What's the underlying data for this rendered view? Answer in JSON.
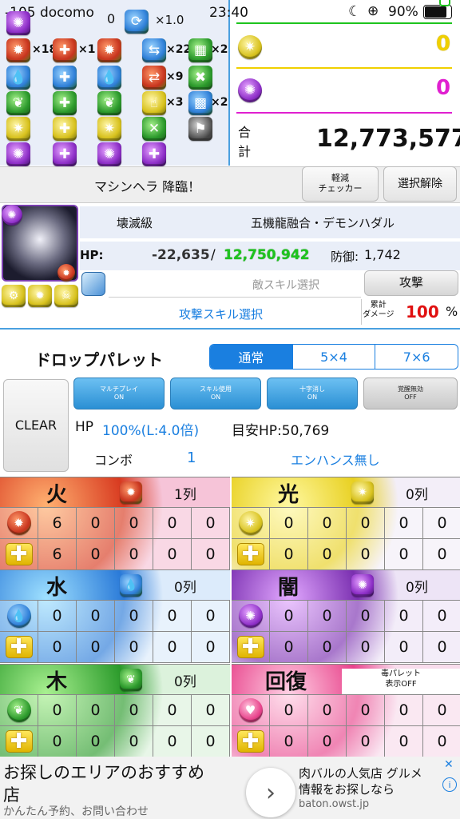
{
  "status": {
    "signal": "-105 docomo",
    "wifi_val": "0",
    "time": "23:40",
    "battery": "90%",
    "speed": "×1.0"
  },
  "counts": {
    "r1": [
      "×18",
      "×1",
      "",
      "×22",
      "×2"
    ],
    "r2": [
      "",
      "",
      "",
      "×9",
      ""
    ],
    "r3": [
      "",
      "",
      "",
      "×3",
      "×2"
    ]
  },
  "right_panel": {
    "light_val": "0",
    "dark_val": "0",
    "total_label_1": "合",
    "total_label_2": "計",
    "total": "12,773,577"
  },
  "toolbar": {
    "title": "マシンヘラ 降臨！",
    "checker": "軽減\nチェッカー",
    "clear_select": "選択解除"
  },
  "enemy": {
    "difficulty": "壊滅級",
    "name": "五機龍融合・デモンハダル",
    "hp_label": "HP:",
    "hp_damage": "-22,635",
    "hp_sep": "/",
    "hp_value": "12,750,942",
    "def_label": "防御:",
    "def_value": "1,742",
    "enemy_skill_placeholder": "敵スキル選択",
    "attack_btn": "攻撃",
    "attack_skill": "攻撃スキル選択",
    "cum_label": "累計\nダメージ",
    "cum_value": "100",
    "cum_unit": "%"
  },
  "palette": {
    "title": "ドロップパレット",
    "seg": [
      "通常",
      "5×4",
      "7×6"
    ],
    "clear": "CLEAR",
    "multi": [
      "マルチプレイ",
      "ON"
    ],
    "skill": [
      "スキル使用",
      "ON"
    ],
    "cross": [
      "十字消し",
      "ON"
    ],
    "awake": [
      "覚醒無効",
      "OFF"
    ],
    "hp_label": "HP",
    "hp_value": "100%(L:4.0倍)",
    "target": "目安HP:50,769",
    "combo_label": "コンボ",
    "combo_value": "1",
    "enhance": "エンハンス無し",
    "poison": "毒パレット\n表示OFF"
  },
  "attrs": {
    "fire": {
      "label": "火",
      "rows": "1列",
      "r1": [
        "6",
        "0",
        "0",
        "0",
        "0"
      ],
      "r2": [
        "6",
        "0",
        "0",
        "0",
        "0"
      ]
    },
    "light": {
      "label": "光",
      "rows": "0列",
      "r1": [
        "0",
        "0",
        "0",
        "0",
        "0"
      ],
      "r2": [
        "0",
        "0",
        "0",
        "0",
        "0"
      ]
    },
    "water": {
      "label": "水",
      "rows": "0列",
      "r1": [
        "0",
        "0",
        "0",
        "0",
        "0"
      ],
      "r2": [
        "0",
        "0",
        "0",
        "0",
        "0"
      ]
    },
    "dark": {
      "label": "闇",
      "rows": "0列",
      "r1": [
        "0",
        "0",
        "0",
        "0",
        "0"
      ],
      "r2": [
        "0",
        "0",
        "0",
        "0",
        "0"
      ]
    },
    "wood": {
      "label": "木",
      "rows": "0列",
      "r1": [
        "0",
        "0",
        "0",
        "0",
        "0"
      ],
      "r2": [
        "0",
        "0",
        "0",
        "0",
        "0"
      ]
    },
    "heal": {
      "label": "回復",
      "r1": [
        "0",
        "0",
        "0",
        "0",
        "0"
      ],
      "r2": [
        "0",
        "0",
        "0",
        "0",
        "0"
      ]
    }
  },
  "ad": {
    "line1": "お探しのエリアのおすすめ",
    "line2": "店",
    "line3": "かんたん予約、お問い合わせ",
    "right1": "肉バルの人気店 グルメ",
    "right2": "情報をお探しなら",
    "right3": "baton.owst.jp",
    "arrow": "›"
  },
  "colors": {
    "accent": "#1a7fe0",
    "green": "#1ec41e",
    "red": "#e01010",
    "yellow": "#f0d000",
    "magenta": "#e020d0"
  }
}
